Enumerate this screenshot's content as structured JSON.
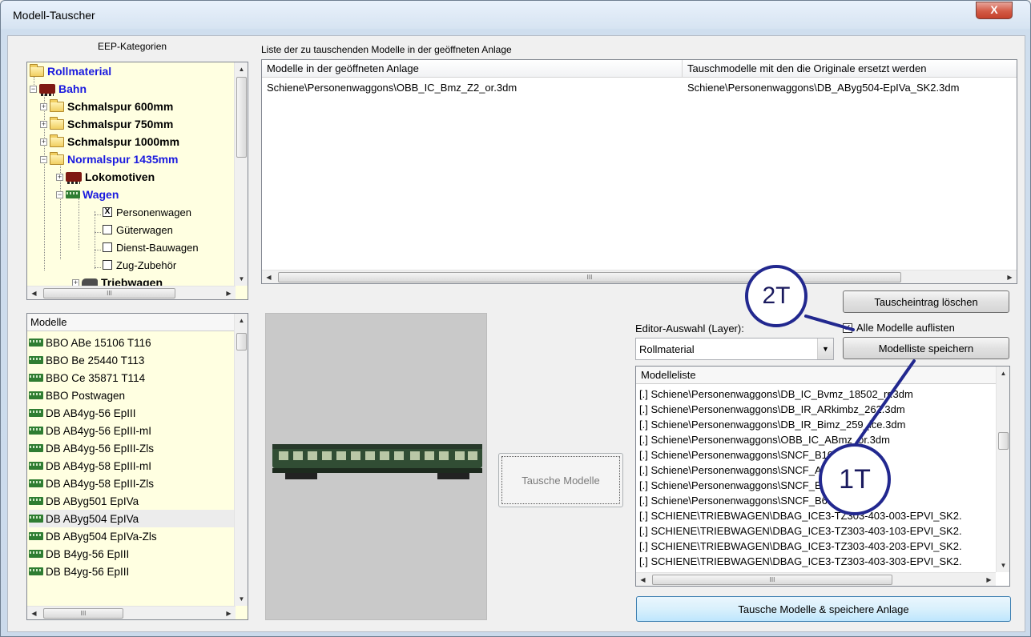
{
  "window": {
    "title": "Modell-Tauscher",
    "close_glyph": "X"
  },
  "categories": {
    "header": "EEP-Kategorien",
    "tree": [
      {
        "label": "Rollmaterial"
      },
      {
        "label": "Bahn"
      },
      {
        "label": "Schmalspur 600mm"
      },
      {
        "label": "Schmalspur 750mm"
      },
      {
        "label": "Schmalspur 1000mm"
      },
      {
        "label": "Normalspur 1435mm"
      },
      {
        "label": "Lokomotiven"
      },
      {
        "label": "Wagen"
      },
      {
        "label": "Personenwagen",
        "checked": true
      },
      {
        "label": "Güterwagen",
        "checked": false
      },
      {
        "label": "Dienst-Bauwagen",
        "checked": false
      },
      {
        "label": "Zug-Zubehör",
        "checked": false
      },
      {
        "label": "Triebwagen"
      }
    ],
    "scroll_glyph": "III"
  },
  "swap_list": {
    "header": "Liste der zu tauschenden Modelle in der geöffneten Anlage",
    "columns": [
      "Modelle in der geöffneten Anlage",
      "Tauschmodelle mit den die Originale ersetzt werden"
    ],
    "rows": [
      {
        "original": "Schiene\\Personenwaggons\\OBB_IC_Bmz_Z2_or.3dm",
        "replacement": "Schiene\\Personenwaggons\\DB_AByg504-EpIVa_SK2.3dm"
      }
    ],
    "scroll_glyph": "III"
  },
  "models": {
    "header": "Modelle",
    "items": [
      "BBO ABe 15106 T116",
      "BBO Be 25440 T113",
      "BBO Ce 35871 T114",
      "BBO Postwagen",
      "DB AB4yg-56 EpIII",
      "DB AB4yg-56 EpIII-mI",
      "DB AB4yg-56 EpIII-Zls",
      "DB AB4yg-58 EpIII-mI",
      "DB AB4yg-58 EpIII-Zls",
      "DB AByg501 EpIVa",
      "DB AByg504 EpIVa",
      "DB AByg504 EpIVa-Zls",
      "DB B4yg-56 EpIII",
      "DB B4yg-56 EpIII"
    ],
    "selected_index": 10,
    "scroll_glyph": "III"
  },
  "buttons": {
    "delete_entry": "Tauscheintrag löschen",
    "swap_models": "Tausche Modelle",
    "save_list": "Modelliste speichern",
    "swap_and_save": "Tausche Modelle & speichere Anlage"
  },
  "editor_select": {
    "label": "Editor-Auswahl (Layer):",
    "value": "Rollmaterial"
  },
  "list_all": {
    "label": "Alle Modelle auflisten",
    "checked": true
  },
  "model_list": {
    "header": "Modelleliste",
    "items": [
      "[.] Schiene\\Personenwaggons\\DB_IC_Bvmz_18502_rr.3dm",
      "[.] Schiene\\Personenwaggons\\DB_IR_ARkimbz_262.3dm",
      "[.] Schiene\\Personenwaggons\\DB_IR_Bimz_259_ice.3dm",
      "[.] Schiene\\Personenwaggons\\OBB_IC_ABmz_or.3dm",
      "[.] Schiene\\Personenwaggons\\SNCF_B10c19u.3dm",
      "[.] Schiene\\Personenwaggons\\SNCF_A10c10ux.3dm",
      "[.] Schiene\\Personenwaggons\\SNCF_B11u.3dm",
      "[.] Schiene\\Personenwaggons\\SNCF_B6Dd2u.3dm",
      "[.] SCHIENE\\TRIEBWAGEN\\DBAG_ICE3-TZ303-403-003-EPVI_SK2.",
      "[.] SCHIENE\\TRIEBWAGEN\\DBAG_ICE3-TZ303-403-103-EPVI_SK2.",
      "[.] SCHIENE\\TRIEBWAGEN\\DBAG_ICE3-TZ303-403-203-EPVI_SK2.",
      "[.] SCHIENE\\TRIEBWAGEN\\DBAG_ICE3-TZ303-403-303-EPVI_SK2."
    ],
    "scroll_glyph": "III"
  },
  "annotations": {
    "badge_1": "1T",
    "badge_2": "2T",
    "color": "#22288f"
  }
}
